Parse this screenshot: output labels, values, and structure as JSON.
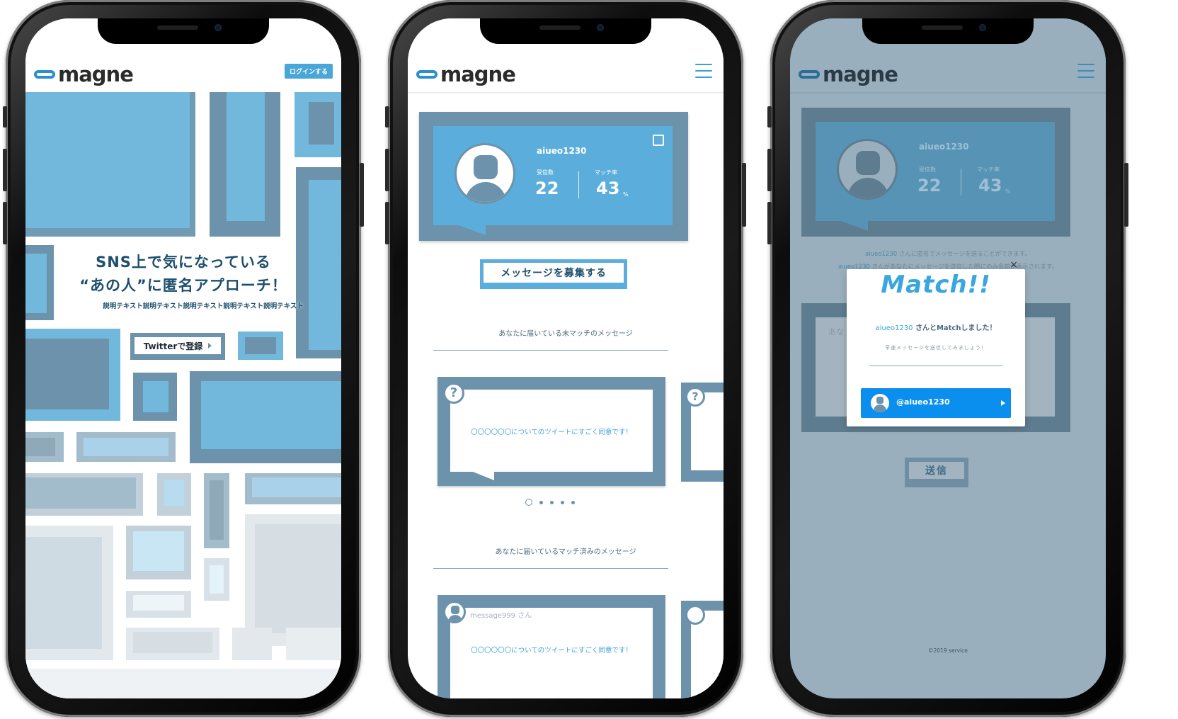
{
  "app": {
    "logo_text": "magne"
  },
  "screen1": {
    "login_button": "ログインする",
    "headline_line1": "SNS上で気になっている",
    "headline_line2": "“あの人”に匿名アプローチ！",
    "description": "説明テキスト説明テキスト説明テキスト説明テキスト説明テキスト",
    "twitter_button": "Twitterで登録"
  },
  "screen2": {
    "username": "aiueo1230",
    "received_label": "受信数",
    "received_value": "22",
    "match_label": "マッチ率",
    "match_value": "43",
    "match_unit": "%",
    "recruit_button": "メッセージを募集する",
    "unmatched_heading": "あなたに届いている未マッチのメッセージ",
    "unmatched_message": "〇〇〇〇〇〇についてのツイートにすごく同意です！",
    "matched_heading": "あなたに届いているマッチ済みのメッセージ",
    "matched_sender": "message999 さん",
    "matched_message": "〇〇〇〇〇〇についてのツイートにすごく同意です！",
    "carousel_dots": 5
  },
  "screen3": {
    "username": "aiueo1230",
    "received_label": "受信数",
    "received_value": "22",
    "match_label": "マッチ率",
    "match_value": "43",
    "match_unit": "%",
    "info_line1_user": "aiueo1230",
    "info_line1_rest": " さんに匿名でメッセージを送ることができます。",
    "info_line2_user": "aiueo1230",
    "info_line2_rest": " さんがあなたにメッセージを送信した際にのみ名前が表示されます。",
    "input_placeholder": "あな",
    "send_button": "送信",
    "close_icon": "×",
    "modal_title": "Match!!",
    "modal_user": "aiueo1230",
    "modal_text": " さんとMatchしました！",
    "modal_subtext": "早速メッセージを送信してみましょう！",
    "modal_handle": "@aiueo1230",
    "footer": "©2019 service"
  },
  "colors": {
    "accent": "#49a7d8",
    "frame": "#6c93ab",
    "button_blue": "#0b8fef",
    "overlay": "#9aafbd"
  }
}
